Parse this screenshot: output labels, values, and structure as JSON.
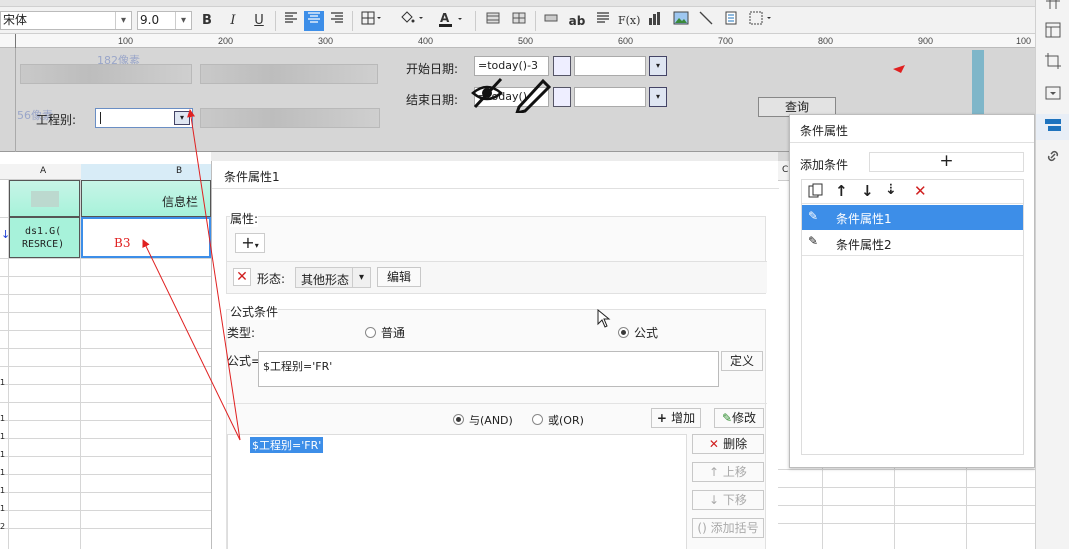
{
  "toolbar": {
    "font_name": "宋体",
    "font_size": "9.0",
    "bold": "B",
    "italic": "I",
    "underline": "U",
    "text_tool": "ab",
    "formula_tool": "F(x)"
  },
  "ruler": {
    "ticks": [
      "100",
      "200",
      "300",
      "400",
      "500",
      "600",
      "700",
      "800",
      "900",
      "100"
    ]
  },
  "params": {
    "px_hint_1": "182像素",
    "px_hint_2": "56像素",
    "start_date_label": "开始日期:",
    "start_date_value": "=today()-3",
    "end_date_label": "结束日期:",
    "end_date_value": "=today()",
    "project_label": "工程别:",
    "query_button": "查询"
  },
  "sheet": {
    "col_a": "A",
    "col_b": "B",
    "col_c": "C",
    "header_b": "信息栏",
    "cell_a": "ds1.G(\nRESRCE)",
    "cell_b3": "B3"
  },
  "dialog": {
    "title": "条件属性1",
    "props_label": "属性:",
    "shape_label": "形态:",
    "shape_value": "其他形态",
    "edit_button": "编辑",
    "formula_cond_label": "公式条件",
    "type_label": "类型:",
    "type_normal": "普通",
    "type_formula": "公式",
    "formula_label": "公式=",
    "formula_value": "$工程别='FR'",
    "define_button": "定义",
    "and_label": "与(AND)",
    "or_label": "或(OR)",
    "add_button": "增加",
    "modify_button": "修改",
    "condition_item": "$工程别='FR'",
    "delete_button": "删除",
    "move_up_button": "上移",
    "move_down_button": "下移",
    "add_bracket_button": "添加括号"
  },
  "cond_panel": {
    "title": "条件属性",
    "add_condition_label": "添加条件",
    "add_symbol": "+",
    "items": [
      "条件属性1",
      "条件属性2"
    ]
  },
  "colors": {
    "selected_blue": "#3d8ee8",
    "header_green": "#a7f2da",
    "arrow_red": "#e02020"
  }
}
